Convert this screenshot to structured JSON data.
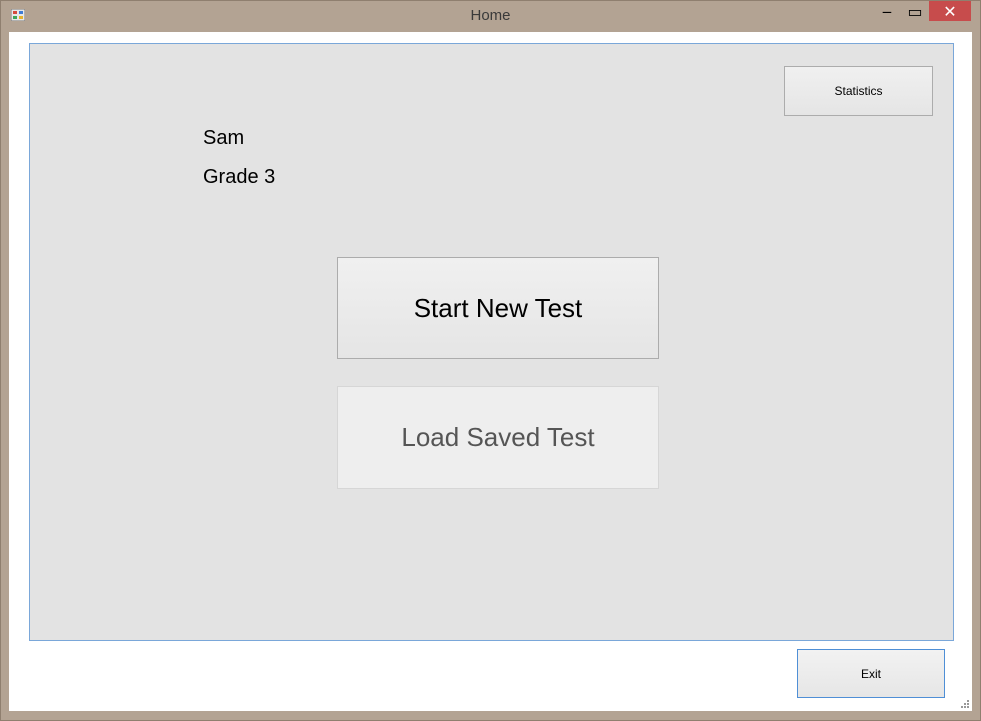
{
  "window": {
    "title": "Home",
    "controls": {
      "minimize": "‒",
      "maximize": "▭",
      "close": "✕"
    },
    "icons": {
      "app": "app-icon",
      "resize": "resize-grip-icon"
    }
  },
  "user": {
    "name": "Sam",
    "grade": "Grade 3"
  },
  "buttons": {
    "statistics": "Statistics",
    "start_new_test": "Start New Test",
    "load_saved_test": "Load Saved Test",
    "exit": "Exit"
  },
  "colors": {
    "titlebar": "#b3a393",
    "panel": "#e3e3e3",
    "close_button": "#c74c4c",
    "exit_border": "#4f8fd6"
  }
}
